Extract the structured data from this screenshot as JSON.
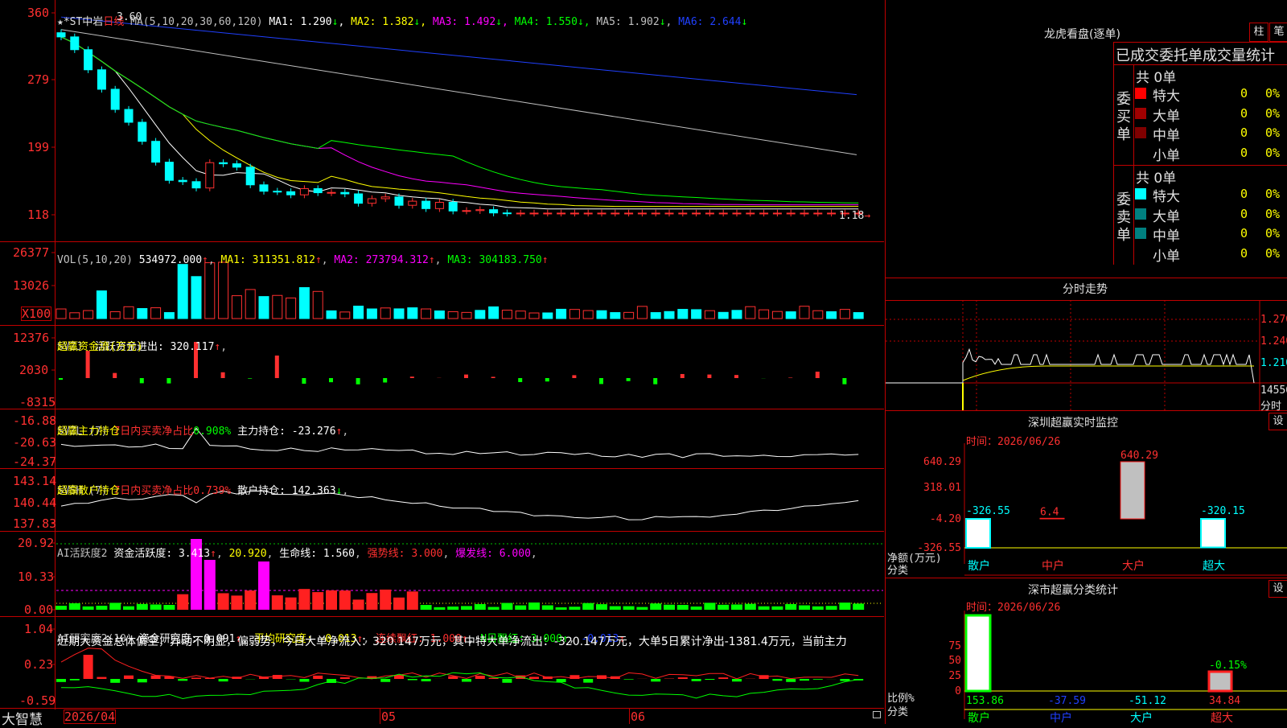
{
  "main": {
    "stock_name": "★*ST中岩",
    "period": "日线",
    "ma_label": "MA(5,10,20,30,60,120)",
    "ma": [
      {
        "label": "MA1:",
        "value": "1.290",
        "arrow": "↓",
        "color": "#ffffff"
      },
      {
        "label": "MA2:",
        "value": "1.382",
        "arrow": "↓",
        "color": "#ffff00"
      },
      {
        "label": "MA3:",
        "value": "1.492",
        "arrow": "↓",
        "color": "#ff00ff"
      },
      {
        "label": "MA4:",
        "value": "1.550",
        "arrow": "↓",
        "color": "#00ff00"
      },
      {
        "label": "MA5:",
        "value": "1.902",
        "arrow": "↓",
        "color": "#c0c0c0"
      },
      {
        "label": "MA6:",
        "value": "2.644",
        "arrow": "↓",
        "color": "#0000ff"
      }
    ],
    "high_mark": "3.60",
    "low_mark": "1.18",
    "y_ticks": [
      "360",
      "279",
      "199",
      "118"
    ]
  },
  "vol": {
    "label": "VOL(5,10,20)",
    "value": "534972.000",
    "ma": [
      {
        "label": "MA1:",
        "value": "311351.812",
        "arrow": "↑",
        "color": "#ffff00"
      },
      {
        "label": "MA2:",
        "value": "273794.312",
        "arrow": "↑",
        "color": "#ff00ff"
      },
      {
        "label": "MA3:",
        "value": "304183.750",
        "arrow": "↑",
        "color": "#00ff00"
      }
    ],
    "y_ticks": [
      "26377",
      "13026"
    ],
    "unit": "X100"
  },
  "svzj": {
    "label": "SVZJ",
    "desc": "活跃资金进出:",
    "value": "320.117",
    "arrow": "↑",
    "sub": "超赢资金流(万元)",
    "y_ticks": [
      "12376",
      "2030",
      "-8315"
    ]
  },
  "svzl": {
    "label": "SVZL (7)",
    "desc": "7日内买卖净占比",
    "ratio": "0.908%",
    "desc2": "主力持仓:",
    "value": "-23.276",
    "arrow": "↑",
    "sub": "超赢主力持仓",
    "y_ticks": [
      "-16.88",
      "-20.63",
      "-24.37"
    ]
  },
  "svsh": {
    "label": "SVSH (7)",
    "desc": "7日内买卖净占比",
    "ratio": "0.739%",
    "desc2": "散户持仓:",
    "value": "142.363",
    "arrow": "↓",
    "sub": "超赢散户持仓",
    "y_ticks": [
      "143.14",
      "140.44",
      "137.83"
    ]
  },
  "ai1": {
    "label": "AI活跃度2",
    "desc": "资金活跃度:",
    "value": "3.413",
    "v2": "20.920",
    "desc2": "生命线:",
    "v3": "1.560",
    "desc3": "强势线:",
    "v4": "3.000",
    "desc4": "爆发线:",
    "v5": "6.000",
    "y_ticks": [
      "20.92",
      "10.33",
      "0.00"
    ]
  },
  "ai2": {
    "label": "AI研究度2(10)",
    "desc": "资金研究度:",
    "value": "0.091",
    "desc2": "平均研究度:",
    "v2": "-0.013",
    "desc3": "连续飘红:",
    "v3": "1.000",
    "desc4": "N日飘红:",
    "v4": "3.000",
    "v5": "-0.013",
    "comment": "近期大资金总体偏空，异动不明显，偏弱势，今日大单净流入：320.147万元，其中特大单净流出：-320.147万元，大单5日累计净出-1381.4万元，当前主力",
    "y_ticks": [
      "1.04",
      "0.23",
      "-0.59"
    ]
  },
  "xaxis": {
    "brand": "大智慧",
    "labels": [
      "2026/04",
      "05",
      "06"
    ]
  },
  "lhb": {
    "title": "龙虎看盘(逐单)",
    "btn1": "柱",
    "btn2": "笔",
    "header": "已成交委托单成交量统计",
    "buy": {
      "side": "委买单",
      "total": "共 0单",
      "rows": [
        {
          "label": "特大",
          "count": "0",
          "pct": "0%",
          "color": "#ff0000"
        },
        {
          "label": "大单",
          "count": "0",
          "pct": "0%",
          "color": "#a00000"
        },
        {
          "label": "中单",
          "count": "0",
          "pct": "0%",
          "color": "#800000"
        },
        {
          "label": "小单",
          "count": "0",
          "pct": "0%",
          "color": ""
        }
      ]
    },
    "sell": {
      "side": "委卖单",
      "total": "共 0单",
      "rows": [
        {
          "label": "特大",
          "count": "0",
          "pct": "0%",
          "color": "#00ffff"
        },
        {
          "label": "大单",
          "count": "0",
          "pct": "0%",
          "color": "#008080"
        },
        {
          "label": "中单",
          "count": "0",
          "pct": "0%",
          "color": "#008080"
        },
        {
          "label": "小单",
          "count": "0",
          "pct": "0%",
          "color": ""
        }
      ]
    }
  },
  "fenshi": {
    "title": "分时走势",
    "y_ticks": [
      "1.270",
      "1.240",
      "1.210",
      "14556"
    ],
    "unit": "分时"
  },
  "monitor": {
    "title": "深圳超赢实时监控",
    "btn": "设",
    "time_label": "时间：",
    "date": "2026/06/26",
    "y_ticks": [
      "640.29",
      "318.01",
      "-4.20",
      "-326.55"
    ],
    "ylabel": "净额(万元)",
    "xlabel": "分类",
    "categories": [
      "散户",
      "中户",
      "大户",
      "超大"
    ],
    "values": [
      "-326.55",
      "6.4",
      "640.29",
      "-320.15"
    ]
  },
  "stats": {
    "title": "深市超赢分类统计",
    "btn": "设",
    "time_label": "时间：",
    "date": "2026/06/26",
    "y_ticks": [
      "75",
      "50",
      "25",
      "0"
    ],
    "ylabel": "比例%",
    "xlabel": "分类",
    "categories": [
      "散户",
      "中户",
      "大户",
      "超大"
    ],
    "values": [
      "153.86",
      "-37.59",
      "-51.12",
      "34.84"
    ],
    "pct_label": "-0.15%"
  }
}
